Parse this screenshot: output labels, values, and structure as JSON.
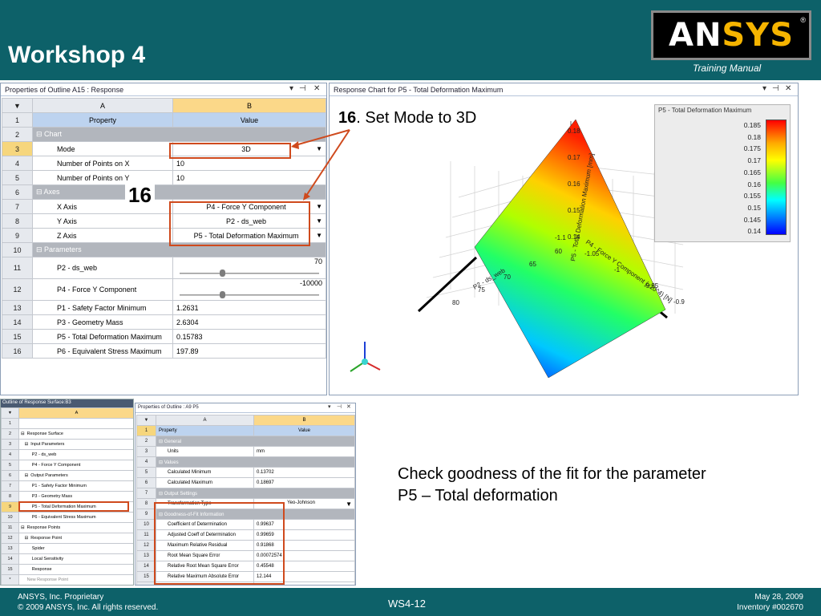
{
  "slide": {
    "title": "Workshop 4",
    "logo_text_a": "AN",
    "logo_text_b": "SYS",
    "logo_reg": "®",
    "training_manual": "Training Manual"
  },
  "footer": {
    "company": "ANSYS, Inc. Proprietary",
    "copyright": "© 2009 ANSYS, Inc.  All rights reserved.",
    "page": "WS4-12",
    "date": "May 28, 2009",
    "inventory": "Inventory #002670"
  },
  "props_panel": {
    "title": "Properties of Outline A15 : Response",
    "col_a": "A",
    "col_b": "B",
    "rows": [
      {
        "n": "1",
        "a": "Property",
        "b": "Value"
      },
      {
        "n": "2",
        "a": "Chart",
        "b": ""
      },
      {
        "n": "3",
        "a": "Mode",
        "b": "3D"
      },
      {
        "n": "4",
        "a": "Number of Points on X",
        "b": "10"
      },
      {
        "n": "5",
        "a": "Number of Points on Y",
        "b": "10"
      },
      {
        "n": "6",
        "a": "Axes",
        "b": ""
      },
      {
        "n": "7",
        "a": "X Axis",
        "b": "P4 - Force Y Component"
      },
      {
        "n": "8",
        "a": "Y Axis",
        "b": "P2 - ds_web"
      },
      {
        "n": "9",
        "a": "Z Axis",
        "b": "P5 - Total Deformation Maximum"
      },
      {
        "n": "10",
        "a": "Parameters",
        "b": ""
      },
      {
        "n": "11",
        "a": "P2 - ds_web",
        "b": "70"
      },
      {
        "n": "12",
        "a": "P4 - Force Y Component",
        "b": "-10000"
      },
      {
        "n": "13",
        "a": "P1 - Safety Factor Minimum",
        "b": "1.2631"
      },
      {
        "n": "14",
        "a": "P3 - Geometry Mass",
        "b": "2.6304"
      },
      {
        "n": "15",
        "a": "P5 - Total Deformation Maximum",
        "b": "0.15783"
      },
      {
        "n": "16",
        "a": "P6 - Equivalent Stress Maximum",
        "b": "197.89"
      }
    ],
    "slider_p2_level": 0.3,
    "slider_p4_level": 0.3
  },
  "chart_panel": {
    "title": "Response Chart for P5 - Total Deformation Maximum",
    "legend_title": "P5 - Total Deformation Maximum"
  },
  "chart_data": {
    "type": "surface-3d",
    "title": "",
    "z_axis_label": "P5 - Total Deformation Maximum  [mm]",
    "x_axis_label": "P4 - Force Y Component  (x10^4) [N]",
    "y_axis_label": "P2 - ds_web",
    "z_ticks": [
      "0.18",
      "0.17",
      "0.16",
      "0.15",
      "0.14"
    ],
    "x_ticks": [
      "-1.1",
      "-1.05",
      "-1",
      "-9.95",
      "-0.9"
    ],
    "y_ticks": [
      "60",
      "65",
      "70",
      "75",
      "80"
    ],
    "legend_values": [
      0.185,
      0.18,
      0.175,
      0.17,
      0.165,
      0.16,
      0.155,
      0.15,
      0.145,
      0.14
    ],
    "legend_labels": [
      "0.185",
      "0.18",
      "0.175",
      "0.17",
      "0.165",
      "0.16",
      "0.155",
      "0.15",
      "0.145",
      "0.14"
    ],
    "colormap": [
      "#ff0000",
      "#ffaa00",
      "#ffff00",
      "#44ff44",
      "#00ffff",
      "#0080ff",
      "#0000ff"
    ],
    "grid": true
  },
  "annotations": {
    "step_num": "16",
    "step_text": ". Set Mode to 3D",
    "callout": "16",
    "fit_note": "Check goodness of the fit for the parameter P5 – Total deformation"
  },
  "outline_panel": {
    "title": "Outline of Response Surface:B3",
    "col_a": "A",
    "rows": [
      {
        "n": "1",
        "label": ""
      },
      {
        "n": "2",
        "label": "⊟  Response Surface"
      },
      {
        "n": "3",
        "label": "   ⊟  Input Parameters"
      },
      {
        "n": "4",
        "label": "         P2 - ds_web"
      },
      {
        "n": "5",
        "label": "         P4 - Force Y Component"
      },
      {
        "n": "6",
        "label": "   ⊟  Output Parameters"
      },
      {
        "n": "7",
        "label": "         P1 - Safety Factor Minimum"
      },
      {
        "n": "8",
        "label": "         P3 - Geometry Mass"
      },
      {
        "n": "9",
        "label": "         P5 - Total Deformation Maximum"
      },
      {
        "n": "10",
        "label": "         P6 - Equivalent Stress Maximum"
      },
      {
        "n": "11",
        "label": "⊟  Response Points"
      },
      {
        "n": "12",
        "label": "   ⊟  Response Point"
      },
      {
        "n": "13",
        "label": "         Spider"
      },
      {
        "n": "14",
        "label": "         Local Sensitivity"
      },
      {
        "n": "15",
        "label": "         Response"
      },
      {
        "n": "*",
        "label": "     New Response Point"
      }
    ]
  },
  "props2_panel": {
    "title": "Properties of Outline : A9 P5",
    "col_a": "A",
    "col_b": "B",
    "rows": [
      {
        "n": "1",
        "a": "Property",
        "b": "Value"
      },
      {
        "n": "2",
        "a": "General",
        "b": ""
      },
      {
        "n": "3",
        "a": "Units",
        "b": "mm"
      },
      {
        "n": "4",
        "a": "Values",
        "b": ""
      },
      {
        "n": "5",
        "a": "Calculated Minimum",
        "b": "0.13702"
      },
      {
        "n": "6",
        "a": "Calculated Maximum",
        "b": "0.18697"
      },
      {
        "n": "7",
        "a": "Output Settings",
        "b": ""
      },
      {
        "n": "8",
        "a": "Transformation Type",
        "b": "Yeo-Johnson"
      },
      {
        "n": "9",
        "a": "Goodness-of-Fit Information",
        "b": ""
      },
      {
        "n": "10",
        "a": "Coefficient of Determination",
        "b": "0.99637"
      },
      {
        "n": "11",
        "a": "Adjusted Coeff of Determination",
        "b": "0.99659"
      },
      {
        "n": "12",
        "a": "Maximum Relative Residual",
        "b": "0.91868"
      },
      {
        "n": "13",
        "a": "Root Mean Square Error",
        "b": "0.00072574"
      },
      {
        "n": "14",
        "a": "Relative Root Mean Square Error",
        "b": "0.45548"
      },
      {
        "n": "15",
        "a": "Relative Maximum Absolute Error",
        "b": "12.144"
      },
      {
        "n": "16",
        "a": "Relative Average Absolute Error",
        "b": "4.6382"
      }
    ]
  }
}
